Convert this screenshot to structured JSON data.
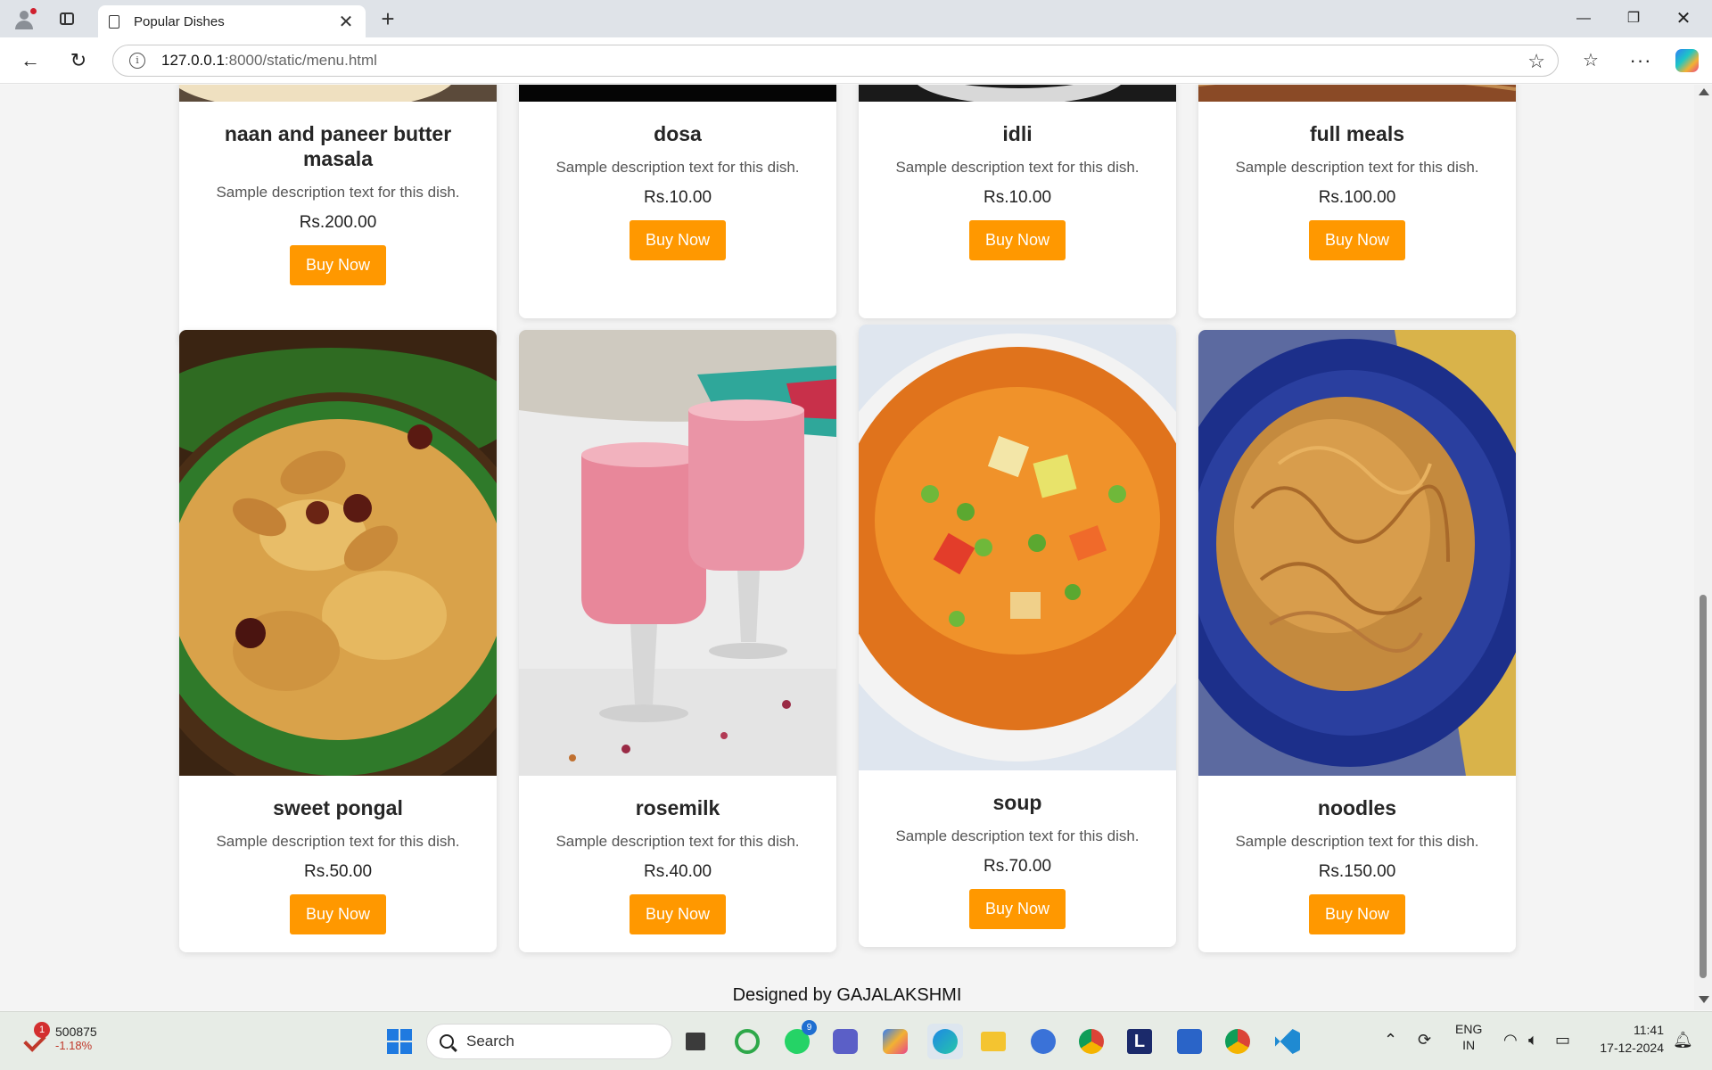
{
  "browser": {
    "tab_title": "Popular Dishes",
    "url_host": "127.0.0.1",
    "url_path": ":8000/static/menu.html"
  },
  "menu": {
    "top_row": [
      {
        "name": "naan and paneer butter masala",
        "description": "Sample description text for this dish.",
        "price": "Rs.200.00",
        "button": "Buy Now"
      },
      {
        "name": "dosa",
        "description": "Sample description text for this dish.",
        "price": "Rs.10.00",
        "button": "Buy Now"
      },
      {
        "name": "idli",
        "description": "Sample description text for this dish.",
        "price": "Rs.10.00",
        "button": "Buy Now"
      },
      {
        "name": "full meals",
        "description": "Sample description text for this dish.",
        "price": "Rs.100.00",
        "button": "Buy Now"
      }
    ],
    "bottom_row": [
      {
        "name": "sweet pongal",
        "description": "Sample description text for this dish.",
        "price": "Rs.50.00",
        "button": "Buy Now"
      },
      {
        "name": "rosemilk",
        "description": "Sample description text for this dish.",
        "price": "Rs.40.00",
        "button": "Buy Now"
      },
      {
        "name": "soup",
        "description": "Sample description text for this dish.",
        "price": "Rs.70.00",
        "button": "Buy Now"
      },
      {
        "name": "noodles",
        "description": "Sample description text for this dish.",
        "price": "Rs.150.00",
        "button": "Buy Now"
      }
    ]
  },
  "footer": {
    "text": "Designed by GAJALAKSHMI"
  },
  "taskbar": {
    "stock_value": "500875",
    "stock_change": "-1.18%",
    "stock_badge": "1",
    "search_label": "Search",
    "whatsapp_badge": "9",
    "lang_line1": "ENG",
    "lang_line2": "IN",
    "time": "11:41",
    "date": "17-12-2024"
  },
  "colors": {
    "accent_button": "#ff9800",
    "scrollbar_thumb": "#8a8a8a"
  }
}
